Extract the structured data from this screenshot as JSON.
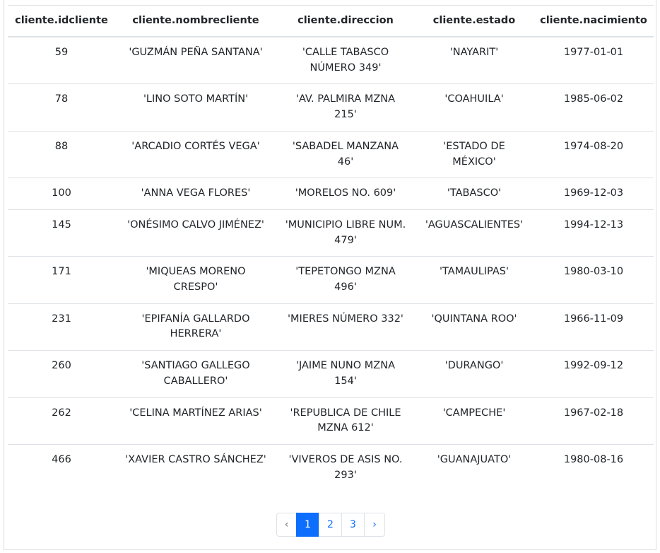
{
  "table": {
    "columns": [
      "cliente.idcliente",
      "cliente.nombrecliente",
      "cliente.direccion",
      "cliente.estado",
      "cliente.nacimiento"
    ],
    "rows": [
      [
        "59",
        "'GUZMÁN PEÑA SANTANA'",
        "'CALLE TABASCO NÚMERO 349'",
        "'NAYARIT'",
        "1977-01-01"
      ],
      [
        "78",
        "'LINO SOTO MARTÍN'",
        "'AV. PALMIRA MZNA 215'",
        "'COAHUILA'",
        "1985-06-02"
      ],
      [
        "88",
        "'ARCADIO CORTÉS VEGA'",
        "'SABADEL MANZANA 46'",
        "'ESTADO DE MÉXICO'",
        "1974-08-20"
      ],
      [
        "100",
        "'ANNA VEGA FLORES'",
        "'MORELOS NO. 609'",
        "'TABASCO'",
        "1969-12-03"
      ],
      [
        "145",
        "'ONÉSIMO CALVO JIMÉNEZ'",
        "'MUNICIPIO LIBRE NUM. 479'",
        "'AGUASCALIENTES'",
        "1994-12-13"
      ],
      [
        "171",
        "'MIQUEAS MORENO CRESPO'",
        "'TEPETONGO MZNA 496'",
        "'TAMAULIPAS'",
        "1980-03-10"
      ],
      [
        "231",
        "'EPIFANÍA GALLARDO HERRERA'",
        "'MIERES NÚMERO 332'",
        "'QUINTANA ROO'",
        "1966-11-09"
      ],
      [
        "260",
        "'SANTIAGO GALLEGO CABALLERO'",
        "'JAIME NUNO MZNA 154'",
        "'DURANGO'",
        "1992-09-12"
      ],
      [
        "262",
        "'CELINA MARTÍNEZ ARIAS'",
        "'REPUBLICA DE CHILE MZNA 612'",
        "'CAMPECHE'",
        "1967-02-18"
      ],
      [
        "466",
        "'XAVIER CASTRO SÁNCHEZ'",
        "'VIVEROS DE ASIS NO. 293'",
        "'GUANAJUATO'",
        "1980-08-16"
      ]
    ]
  },
  "pagination": {
    "prev": "‹",
    "pages": [
      "1",
      "2",
      "3"
    ],
    "current": "1",
    "next": "›"
  },
  "colors": {
    "accent": "#0d6efd",
    "border": "#dee2e6",
    "text": "#212529"
  }
}
